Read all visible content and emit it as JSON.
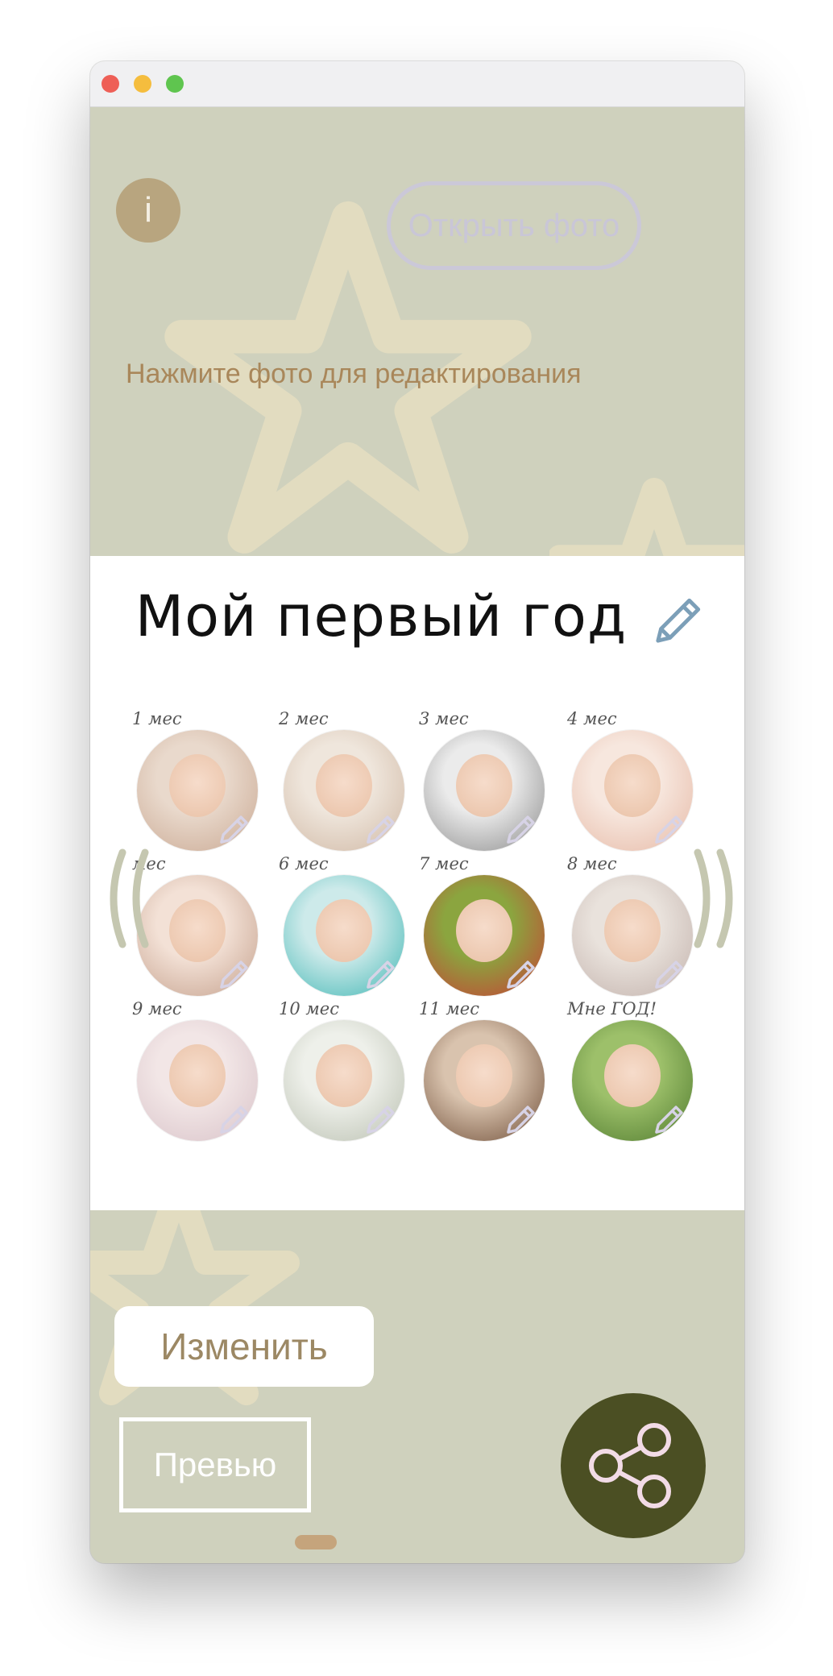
{
  "header": {
    "info_icon": "info-icon",
    "info_glyph": "i",
    "open_photo_label": "Открыть фото",
    "hint": "Нажмите фото для редактирования"
  },
  "card": {
    "title": "Мой первый год",
    "months": [
      {
        "label": "1 мес"
      },
      {
        "label": "2 мес"
      },
      {
        "label": "3 мес"
      },
      {
        "label": "4 мес"
      },
      {
        "label": "мес"
      },
      {
        "label": "6 мес"
      },
      {
        "label": "7 мес"
      },
      {
        "label": "8 мес"
      },
      {
        "label": "9 мес"
      },
      {
        "label": "10 мес"
      },
      {
        "label": "11 мес"
      },
      {
        "label": "Мне ГОД!"
      }
    ]
  },
  "actions": {
    "change_label": "Изменить",
    "preview_label": "Превью",
    "share_icon": "share-icon"
  },
  "colors": {
    "background": "#cfd1bd",
    "accent_text": "#a9875a",
    "share_button": "#4b4f23",
    "info_button": "#b8a57f"
  }
}
